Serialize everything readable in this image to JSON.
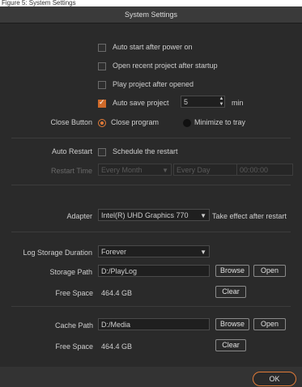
{
  "top_fragment": "Figure 5: System Settings",
  "window": {
    "title": "System Settings"
  },
  "general": {
    "auto_start": {
      "label": "Auto start after power on",
      "checked": false
    },
    "open_recent": {
      "label": "Open recent project after startup",
      "checked": false
    },
    "play_after_open": {
      "label": "Play project after opened",
      "checked": false
    },
    "auto_save": {
      "label": "Auto save project",
      "checked": true,
      "value": "5",
      "unit": "min"
    }
  },
  "close_button": {
    "label": "Close Button",
    "options": [
      {
        "label": "Close program",
        "selected": true
      },
      {
        "label": "Minimize to tray",
        "selected": false
      }
    ]
  },
  "auto_restart": {
    "label": "Auto Restart",
    "schedule_label": "Schedule the restart",
    "schedule_checked": false,
    "restart_time_label": "Restart Time",
    "month_select": "Every Month",
    "day_select": "Every Day",
    "time_value": "00:00:00"
  },
  "adapter": {
    "label": "Adapter",
    "value": "Intel(R) UHD Graphics 770",
    "note": "Take effect after restart"
  },
  "log": {
    "duration_label": "Log Storage Duration",
    "duration_value": "Forever",
    "path_label": "Storage Path",
    "path_value": "D:/PlayLog",
    "browse": "Browse",
    "open": "Open",
    "free_space_label": "Free Space",
    "free_space_value": "464.4 GB",
    "clear": "Clear"
  },
  "cache": {
    "path_label": "Cache Path",
    "path_value": "D:/Media",
    "browse": "Browse",
    "open": "Open",
    "free_space_label": "Free Space",
    "free_space_value": "464.4 GB",
    "clear": "Clear"
  },
  "ok_label": "OK",
  "colors": {
    "accent": "#e07a38",
    "background": "#2a2a2a",
    "text": "#cfcfcf",
    "dim_text": "#6a6a6a"
  }
}
